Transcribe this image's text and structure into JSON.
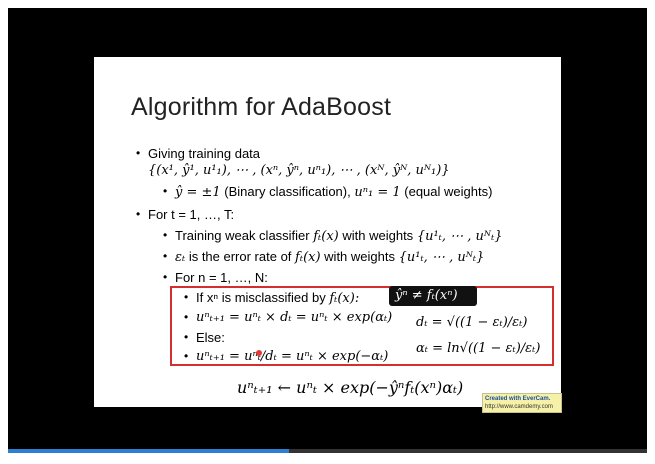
{
  "slide": {
    "title": "Algorithm for AdaBoost",
    "lines": {
      "giving": "Giving training data",
      "dataset": "{(x¹, ŷ¹, u¹₁), ⋯ , (xⁿ, ŷⁿ, uⁿ₁), ⋯ , (xᴺ, ŷᴺ, uᴺ₁)}",
      "yhat_pm": "ŷ = ±1",
      "binary": "(Binary classification),",
      "u1": "uⁿ₁ = 1",
      "equal": "(equal weights)",
      "for_t": "For t = 1, …, T:",
      "train_weak_a": "Training weak classifier",
      "ft": "fₜ(x)",
      "with_weights": "with weights",
      "weights_set": "{u¹ₜ, ⋯ , uᴺₜ}",
      "eps_t": "εₜ",
      "error_rate": "is the error rate of",
      "for_n": "For n = 1, …, N:",
      "if_text": "If xⁿ is misclassified by",
      "ft_colon": "fₜ(x):",
      "update1": "uⁿₜ₊₁ = uⁿₜ × dₜ = uⁿₜ × exp(αₜ)",
      "dt_def": "dₜ = √((1 − εₜ)/εₜ)",
      "else": "Else:",
      "update2": "uⁿₜ₊₁ = uⁿₜ/dₜ = uⁿₜ × exp(−αₜ)",
      "alpha_def": "αₜ = ln√((1 − εₜ)/εₜ)",
      "summary": "uⁿₜ₊₁ ← uⁿₜ × exp(−ŷⁿfₜ(xⁿ)αₜ)"
    },
    "tooltip": "ŷⁿ ≠ fₜ(xⁿ)",
    "watermark": {
      "line1": "Created with EverCam.",
      "line2": "http://www.camdemy.com"
    }
  },
  "player": {
    "progress_fraction": 0.44
  },
  "colors": {
    "highlight_box": "#d32f2f",
    "watermark_bg": "#f6f1a8"
  }
}
